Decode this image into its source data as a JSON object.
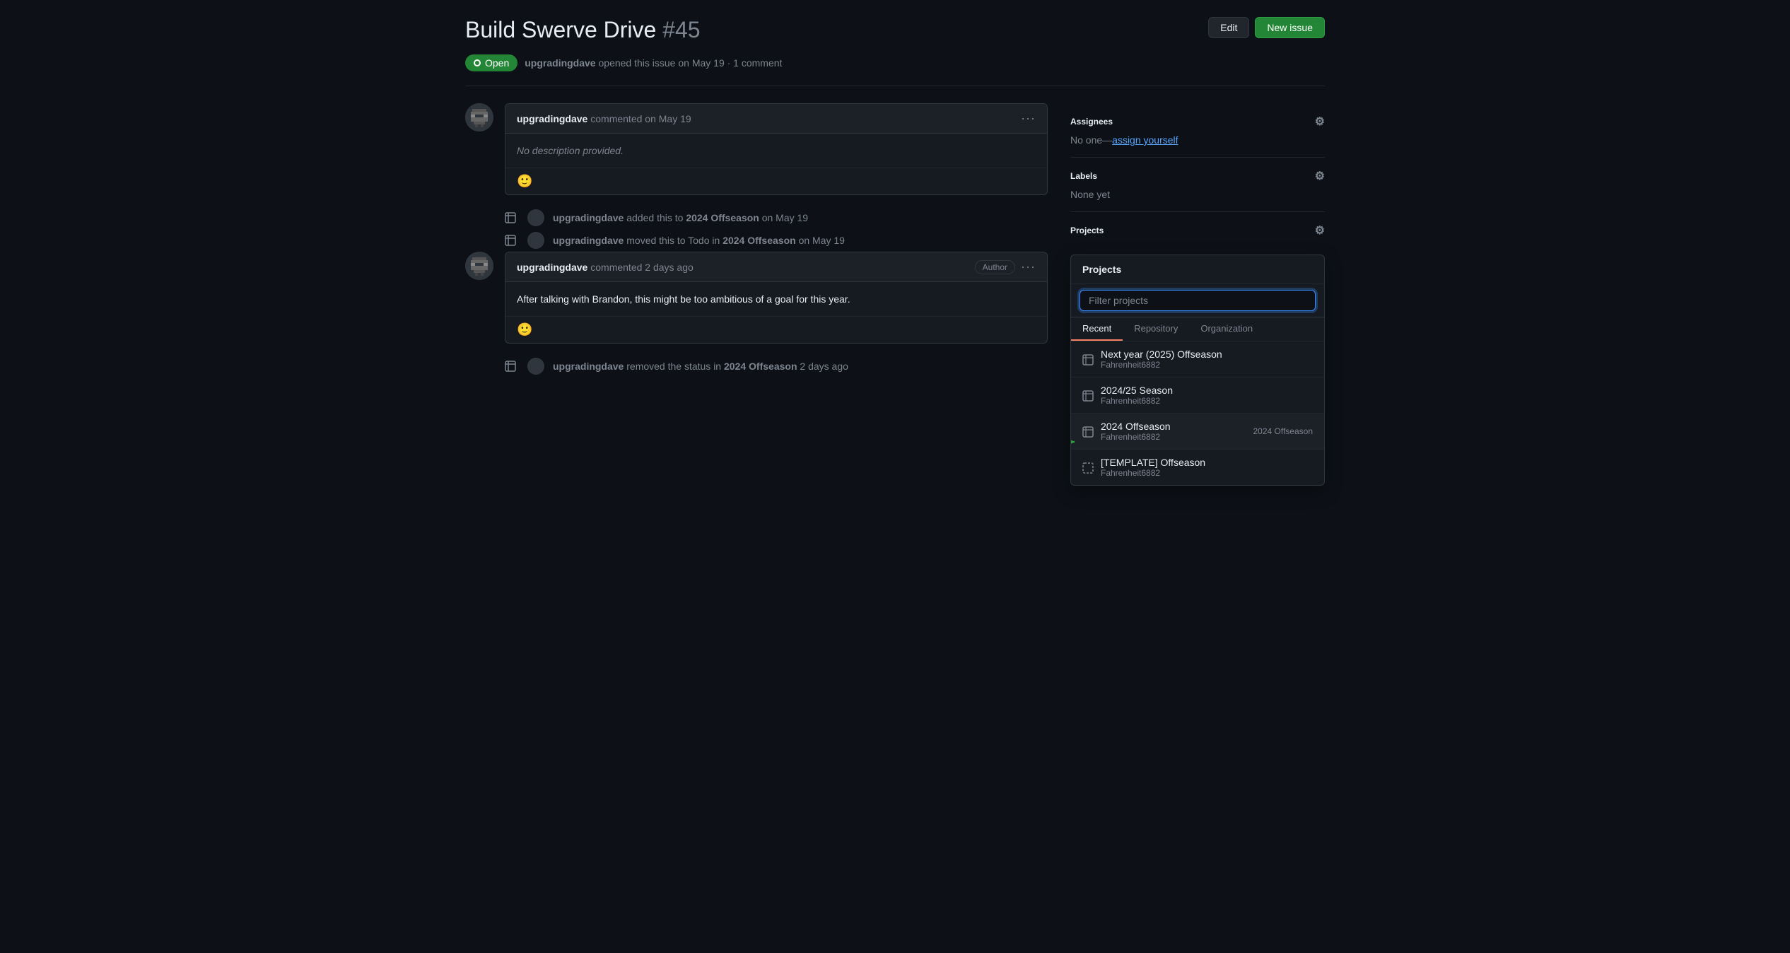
{
  "header": {
    "title": "Build Swerve Drive",
    "issue_number": "#45",
    "edit_button": "Edit",
    "new_issue_button": "New issue"
  },
  "issue": {
    "status": "Open",
    "author": "upgradingdave",
    "opened_text": "opened this issue on May 19 · 1 comment"
  },
  "comments": [
    {
      "id": "comment-1",
      "author": "upgradingdave",
      "timestamp": "commented on May 19",
      "body": "No description provided.",
      "is_italic": true,
      "is_author": false
    },
    {
      "id": "comment-2",
      "author": "upgradingdave",
      "timestamp": "commented 2 days ago",
      "body": "After talking with Brandon, this might be too ambitious of a goal for this year.",
      "is_italic": false,
      "is_author": true
    }
  ],
  "timeline": [
    {
      "id": "tl-1",
      "actor": "upgradingdave",
      "action": "added this to",
      "target": "2024 Offseason",
      "suffix": "on May 19"
    },
    {
      "id": "tl-2",
      "actor": "upgradingdave",
      "action": "moved this to Todo in",
      "target": "2024 Offseason",
      "suffix": "on May 19"
    },
    {
      "id": "tl-3",
      "actor": "upgradingdave",
      "action": "removed the status in",
      "target": "2024 Offseason",
      "suffix": "2 days ago"
    }
  ],
  "sidebar": {
    "assignees_label": "Assignees",
    "assignees_value": "No one",
    "assign_link": "assign yourself",
    "labels_label": "Labels",
    "labels_value": "None yet",
    "projects_label": "Projects"
  },
  "projects_dropdown": {
    "header": "Projects",
    "filter_placeholder": "Filter projects",
    "tabs": [
      "Recent",
      "Repository",
      "Organization"
    ],
    "active_tab": "Recent",
    "items": [
      {
        "id": "proj-1",
        "name": "Next year (2025) Offseason",
        "owner": "Fahrenheit6882",
        "selected": false,
        "tag": ""
      },
      {
        "id": "proj-2",
        "name": "2024/25 Season",
        "owner": "Fahrenheit6882",
        "selected": false,
        "tag": ""
      },
      {
        "id": "proj-3",
        "name": "2024 Offseason",
        "owner": "Fahrenheit6882",
        "selected": true,
        "tag": "2024 Offseason"
      },
      {
        "id": "proj-4",
        "name": "[TEMPLATE] Offseason",
        "owner": "Fahrenheit6882",
        "selected": false,
        "tag": ""
      }
    ]
  }
}
